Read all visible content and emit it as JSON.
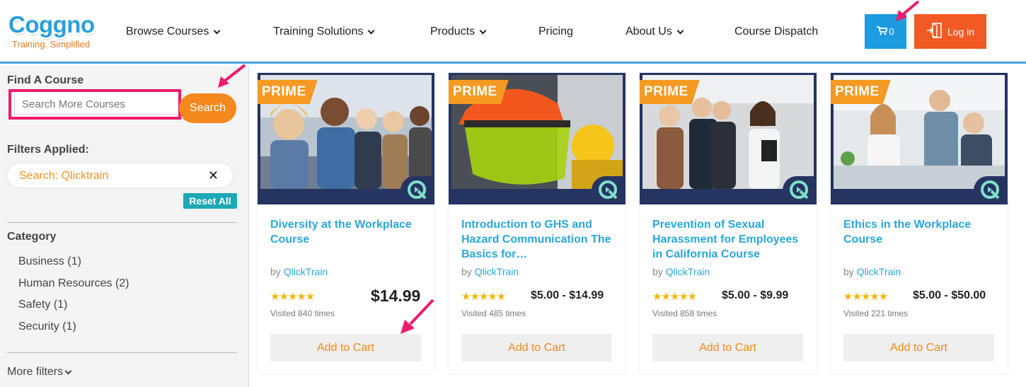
{
  "brand": {
    "name": "Coggno",
    "tagline": "Training. Simplified"
  },
  "nav": [
    {
      "label": "Browse Courses",
      "has_dropdown": true
    },
    {
      "label": "Training Solutions",
      "has_dropdown": true
    },
    {
      "label": "Products",
      "has_dropdown": true
    },
    {
      "label": "Pricing",
      "has_dropdown": false
    },
    {
      "label": "About Us",
      "has_dropdown": true
    },
    {
      "label": "Course Dispatch",
      "has_dropdown": false
    }
  ],
  "cart": {
    "icon": "cart-icon",
    "count": "0"
  },
  "login": {
    "icon": "login-icon",
    "label": "Log in"
  },
  "sidebar": {
    "find_heading": "Find A Course",
    "search_placeholder": "Search More Courses",
    "search_button": "Search",
    "filters_heading": "Filters Applied:",
    "active_filter": "Search: Qlicktrain",
    "reset_label": "Reset All",
    "category_heading": "Category",
    "categories": [
      "Business (1)",
      "Human Resources (2)",
      "Safety (1)",
      "Security (1)"
    ],
    "more_filters": "More filters"
  },
  "courses": [
    {
      "badge": "PRIME",
      "title": "Diversity at the Workplace Course",
      "by": "by",
      "author": "QlickTrain",
      "rating": 5,
      "price": "$14.99",
      "visited": "Visited 840 times",
      "cta": "Add to Cart"
    },
    {
      "badge": "PRIME",
      "title": "Introduction to GHS and Hazard Communication The Basics for…",
      "by": "by",
      "author": "QlickTrain",
      "rating": 5,
      "price": "$5.00 - $14.99",
      "visited": "Visited 485 times",
      "cta": "Add to Cart"
    },
    {
      "badge": "PRIME",
      "title": "Prevention of Sexual Harassment for Employees in California Course",
      "by": "by",
      "author": "QlickTrain",
      "rating": 5,
      "price": "$5.00 - $9.99",
      "visited": "Visited 858 times",
      "cta": "Add to Cart"
    },
    {
      "badge": "PRIME",
      "title": "Ethics in the Workplace Course",
      "by": "by",
      "author": "QlickTrain",
      "rating": 5,
      "price": "$5.00 - $50.00",
      "visited": "Visited 221 times",
      "cta": "Add to Cart"
    }
  ],
  "colors": {
    "accent_blue": "#2aa6d8",
    "accent_orange": "#f5891f",
    "highlight_pink": "#ee1c6a",
    "login_red": "#f15a22",
    "cart_blue": "#1d9be0"
  }
}
